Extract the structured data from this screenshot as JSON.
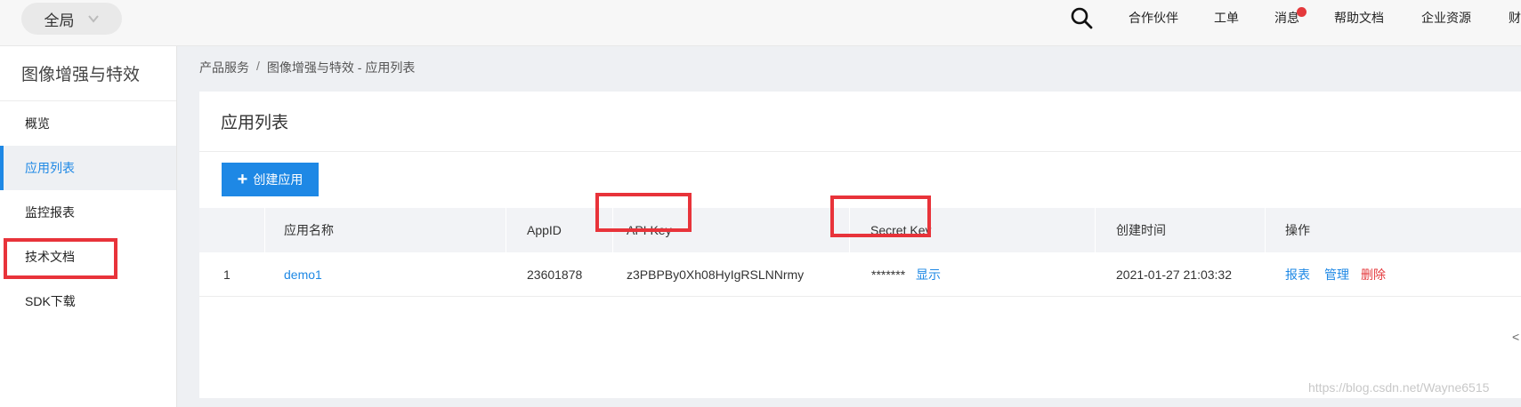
{
  "header": {
    "scope_label": "全局",
    "nav": [
      "合作伙伴",
      "工单",
      "消息",
      "帮助文档",
      "企业资源",
      "财"
    ]
  },
  "sidebar": {
    "title": "图像增强与特效",
    "items": [
      {
        "label": "概览"
      },
      {
        "label": "应用列表"
      },
      {
        "label": "监控报表"
      },
      {
        "label": "技术文档"
      },
      {
        "label": "SDK下载"
      }
    ]
  },
  "breadcrumb": {
    "part1": "产品服务",
    "sep": "/",
    "part2": "图像增强与特效 - 应用列表"
  },
  "main": {
    "title": "应用列表",
    "create_button": "创建应用",
    "table": {
      "columns": [
        "应用名称",
        "AppID",
        "API Key",
        "Secret Key",
        "创建时间",
        "操作"
      ],
      "rows": [
        {
          "index": "1",
          "name": "demo1",
          "appid": "23601878",
          "api_key": "z3PBPBy0Xh08HyIgRSLNNrmy",
          "secret_mask": "*******",
          "secret_show": "显示",
          "created": "2021-01-27 21:03:32",
          "actions": [
            "报表",
            "管理",
            "删除"
          ]
        }
      ]
    },
    "pager_prev": "<"
  },
  "watermark": "https://blog.csdn.net/Wayne6515",
  "colors": {
    "accent": "#1e88e5",
    "highlight": "#e8333a",
    "danger": "#e4393c"
  }
}
